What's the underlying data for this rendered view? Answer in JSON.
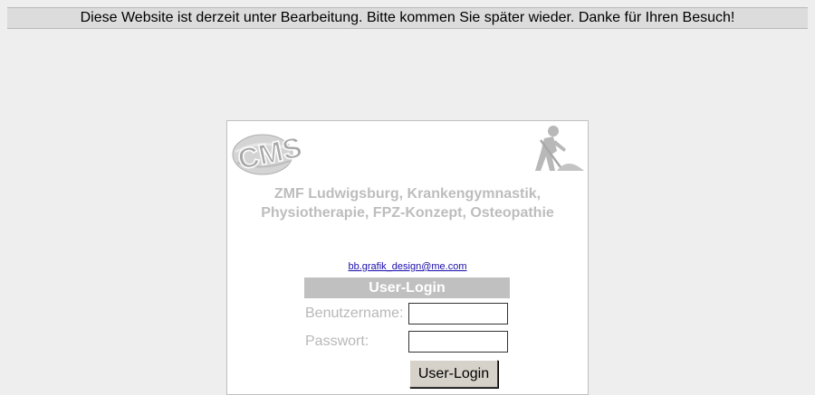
{
  "notice": {
    "text": "Diese Website ist derzeit unter Bearbeitung. Bitte kommen Sie später wieder. Danke für Ihren Besuch!"
  },
  "site": {
    "logo_text": "CMS",
    "title_line1": "ZMF Ludwigsburg, Krankengymnastik,",
    "title_line2": "Physiotherapie, FPZ-Konzept, Osteopathie",
    "email": "bb.grafik_design@me.com"
  },
  "login": {
    "header": "User-Login",
    "username_label": "Benutzername:",
    "password_label": "Passwort:",
    "username_value": "",
    "password_value": "",
    "button_label": "User-Login"
  },
  "icons": {
    "logo": "cms-logo-icon",
    "construction": "construction-worker-icon"
  },
  "colors": {
    "page_bg": "#eeeeee",
    "notice_bg": "#dcdcdc",
    "muted_text": "#bdbdbd",
    "header_bg": "#c0c0c0",
    "link": "#1a0dab"
  }
}
